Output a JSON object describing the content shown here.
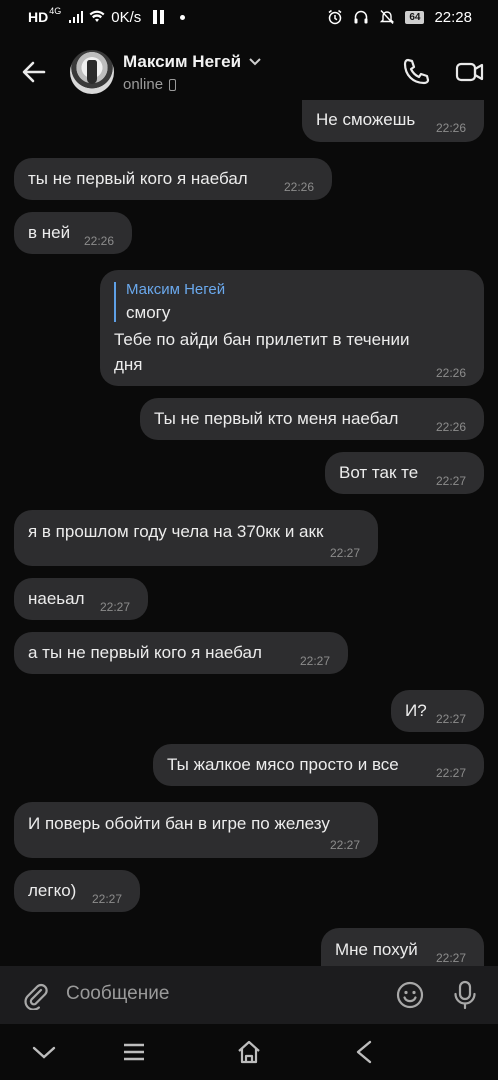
{
  "status_bar": {
    "network": "HD",
    "network_gen": "4G",
    "speed": "0K/s",
    "battery": "64",
    "time": "22:28"
  },
  "header": {
    "contact_name": "Максим Негей",
    "status": "online"
  },
  "messages": [
    {
      "side": "out",
      "text": "Не сможешь",
      "time": "22:26"
    },
    {
      "side": "in",
      "text": "ты не первый кого я наебал",
      "time": "22:26"
    },
    {
      "side": "in",
      "text": "в ней",
      "time": "22:26"
    },
    {
      "side": "out",
      "reply_to_name": "Максим Негей",
      "reply_to_text": "смогу",
      "text_line1": "Тебе по айди бан прилетит в течении",
      "text_line2": "дня",
      "time": "22:26"
    },
    {
      "side": "out",
      "text": "Ты не первый кто меня наебал",
      "time": "22:26"
    },
    {
      "side": "out",
      "text": "Вот так те",
      "time": "22:27"
    },
    {
      "side": "in",
      "text": "я в прошлом году чела на 370кк и акк",
      "time": "22:27"
    },
    {
      "side": "in",
      "text": "наеьал",
      "time": "22:27"
    },
    {
      "side": "in",
      "text": "а ты не первый кого я наебал",
      "time": "22:27"
    },
    {
      "side": "out",
      "text": "И?",
      "time": "22:27"
    },
    {
      "side": "out",
      "text": "Ты жалкое мясо просто и все",
      "time": "22:27"
    },
    {
      "side": "in",
      "text": "И поверь обойти бан в игре по железу",
      "time": "22:27"
    },
    {
      "side": "in",
      "text": "легко)",
      "time": "22:27"
    },
    {
      "side": "out",
      "text": "Мне похуй",
      "time": "22:27"
    }
  ],
  "composer": {
    "placeholder": "Сообщение"
  },
  "icons": {
    "back": "arrow-left-icon",
    "call": "phone-icon",
    "video": "video-camera-icon",
    "attach": "paperclip-icon",
    "emoji": "smiley-icon",
    "mic": "microphone-icon"
  },
  "colors": {
    "background": "#0a0a0a",
    "bubble": "#2d2d2f",
    "reply_accent": "#5ea0e6"
  }
}
